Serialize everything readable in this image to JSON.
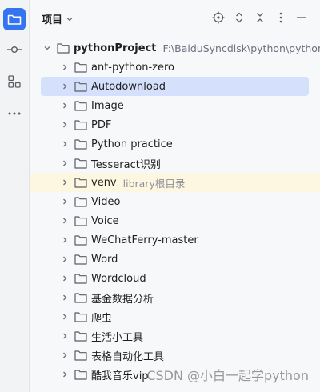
{
  "header": {
    "title": "项目"
  },
  "tree": {
    "root": {
      "name": "pythonProject",
      "path": "F:\\BaiduSyncdisk\\python\\pythonP"
    },
    "items": [
      {
        "name": "ant-python-zero"
      },
      {
        "name": "Autodownload",
        "selected": true
      },
      {
        "name": "Image"
      },
      {
        "name": "PDF"
      },
      {
        "name": "Python practice"
      },
      {
        "name": "Tesseract识别"
      },
      {
        "name": "venv",
        "hint": "library根目录"
      },
      {
        "name": "Video"
      },
      {
        "name": "Voice"
      },
      {
        "name": "WeChatFerry-master"
      },
      {
        "name": "Word"
      },
      {
        "name": "Wordcloud"
      },
      {
        "name": "基金数据分析"
      },
      {
        "name": "爬虫"
      },
      {
        "name": "生活小工具"
      },
      {
        "name": "表格自动化工具"
      },
      {
        "name": "酷我音乐vip"
      }
    ]
  },
  "watermark": "CSDN @小白一起学python",
  "colors": {
    "accent": "#3574f0",
    "selected_row": "#d5e1fc",
    "highlight_row": "#fdf6e0"
  }
}
